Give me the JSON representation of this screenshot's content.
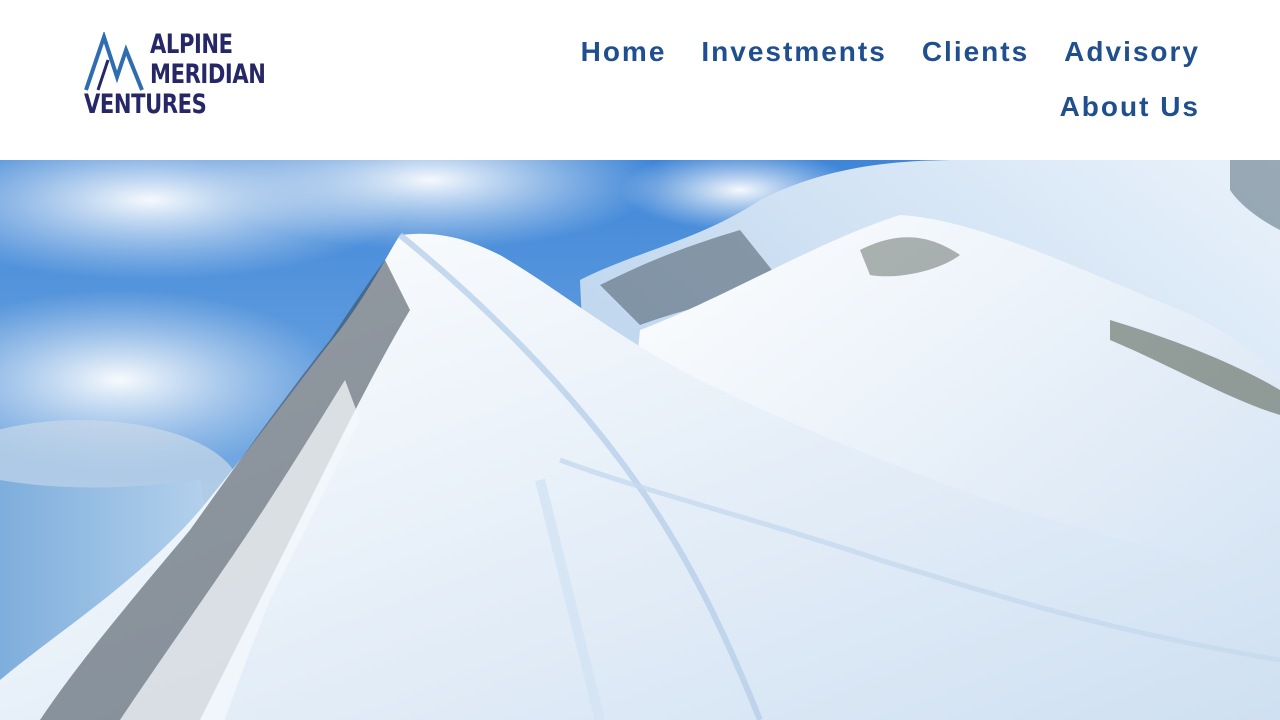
{
  "brand": {
    "name_line1": "ALPINE",
    "name_line2": "MERIDIAN",
    "name_line3": "VENTURES",
    "color": "#262766",
    "accent": "#2f6db0"
  },
  "nav": {
    "items": [
      {
        "label": "Home"
      },
      {
        "label": "Investments"
      },
      {
        "label": "Clients"
      },
      {
        "label": "Advisory"
      },
      {
        "label": "About Us"
      }
    ],
    "color": "#1f4f8f"
  },
  "hero": {
    "image": "snowy-mountain-peak-photo",
    "sky_color": "#4c8fd6",
    "snow_color": "#eef4fb"
  }
}
